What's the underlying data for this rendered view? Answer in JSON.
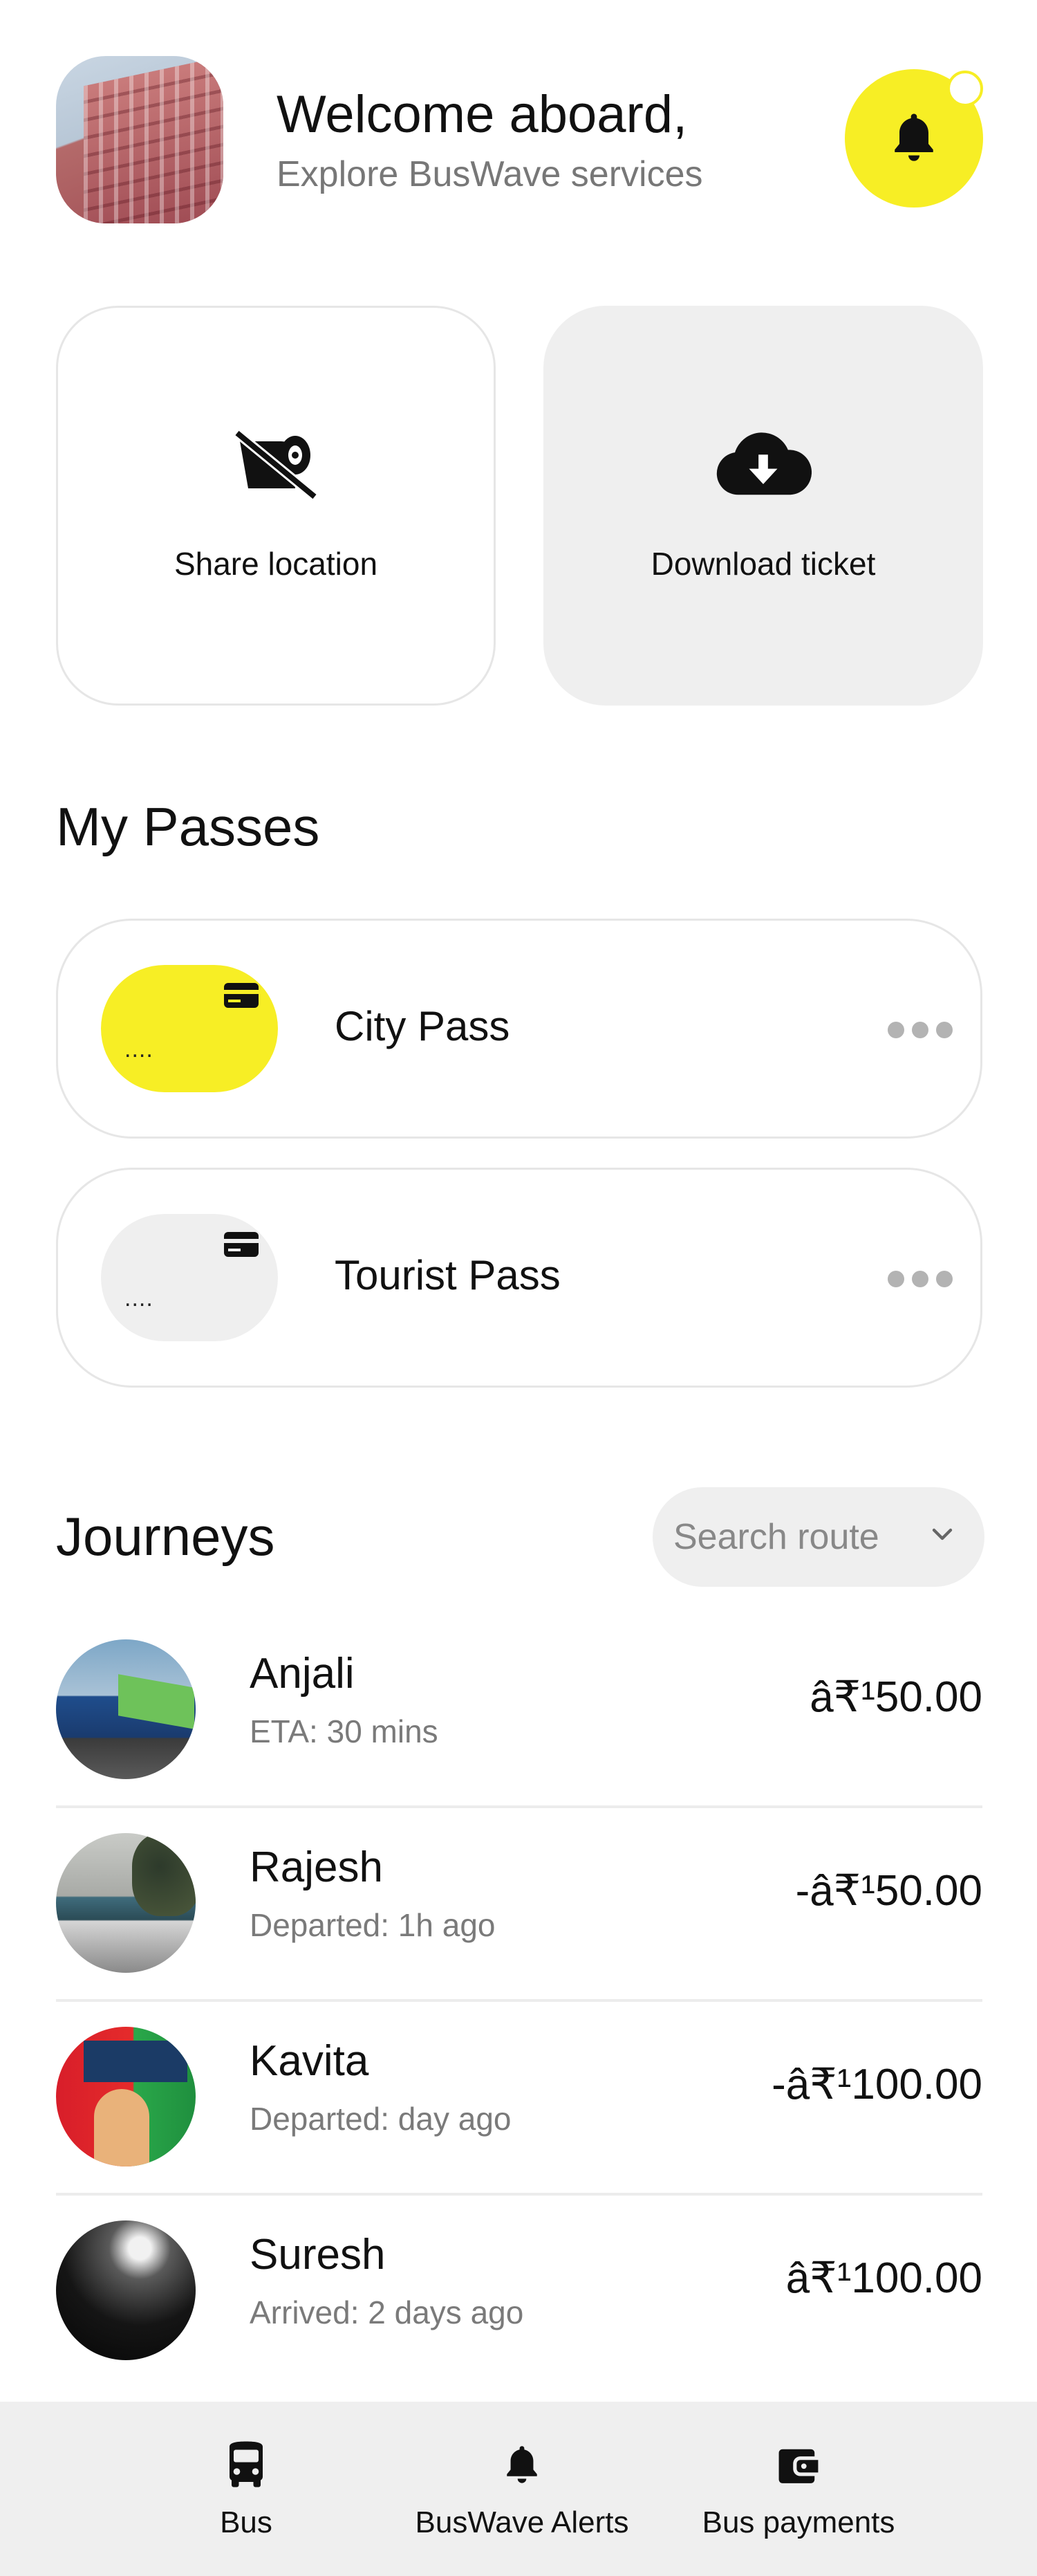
{
  "header": {
    "title": "Welcome aboard,",
    "subtitle": "Explore BusWave services",
    "avatar_icon": "profile-photo",
    "notification_icon": "bell-icon"
  },
  "actions": [
    {
      "label": "Share location",
      "icon": "no-paper-roll-icon"
    },
    {
      "label": "Download ticket",
      "icon": "cloud-download-icon"
    }
  ],
  "passes_section": {
    "title": "My Passes",
    "items": [
      {
        "name": "City Pass",
        "masked": "....",
        "chip_color": "#f7ee25"
      },
      {
        "name": "Tourist Pass",
        "masked": "....",
        "chip_color": "#efefef"
      }
    ]
  },
  "journeys_section": {
    "title": "Journeys",
    "search_placeholder": "Search route",
    "items": [
      {
        "name": "Anjali",
        "status": "ETA: 30 mins",
        "amount": "â₹¹50.00"
      },
      {
        "name": "Rajesh",
        "status": "Departed: 1h ago",
        "amount": "-â₹¹50.00"
      },
      {
        "name": "Kavita",
        "status": "Departed: day ago",
        "amount": "-â₹¹100.00"
      },
      {
        "name": "Suresh",
        "status": "Arrived: 2 days ago",
        "amount": "â₹¹100.00"
      }
    ]
  },
  "bottom_nav": {
    "items": [
      {
        "label": "Bus",
        "icon": "bus-icon"
      },
      {
        "label": "BusWave Alerts",
        "icon": "bell-icon"
      },
      {
        "label": "Bus payments",
        "icon": "wallet-icon"
      }
    ]
  },
  "colors": {
    "accent": "#f7ee25",
    "surface": "#efefef",
    "border": "#e6e6e6",
    "muted_text": "#777777"
  }
}
